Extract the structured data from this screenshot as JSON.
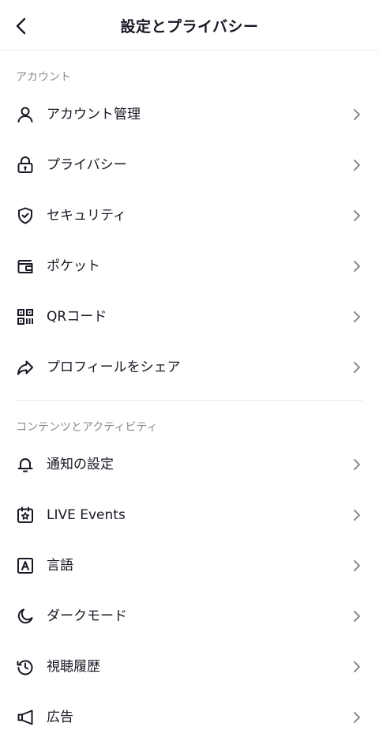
{
  "header": {
    "title": "設定とプライバシー",
    "back_icon": "chevron-left-icon"
  },
  "sections": [
    {
      "label": "アカウント",
      "items": [
        {
          "label": "アカウント管理",
          "icon": "person-icon"
        },
        {
          "label": "プライバシー",
          "icon": "lock-icon"
        },
        {
          "label": "セキュリティ",
          "icon": "shield-check-icon"
        },
        {
          "label": "ポケット",
          "icon": "wallet-icon"
        },
        {
          "label": "QRコード",
          "icon": "qr-code-icon"
        },
        {
          "label": "プロフィールをシェア",
          "icon": "share-arrow-icon"
        }
      ]
    },
    {
      "label": "コンテンツとアクティビティ",
      "items": [
        {
          "label": "通知の設定",
          "icon": "bell-icon"
        },
        {
          "label": "LIVE Events",
          "icon": "calendar-star-icon"
        },
        {
          "label": "言語",
          "icon": "language-a-icon"
        },
        {
          "label": "ダークモード",
          "icon": "moon-icon"
        },
        {
          "label": "視聴履歴",
          "icon": "history-icon"
        },
        {
          "label": "広告",
          "icon": "megaphone-icon"
        }
      ]
    }
  ],
  "colors": {
    "text": "#161823",
    "section_label": "#8a8b91",
    "chevron": "#8a8b91",
    "divider": "#e8e8ea"
  }
}
